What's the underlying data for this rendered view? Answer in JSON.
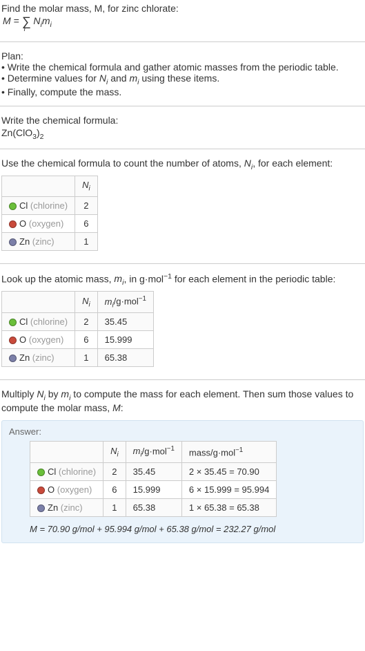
{
  "intro": {
    "line1": "Find the molar mass, M, for zinc chlorate:",
    "eq": "M = ∑ N_i m_i",
    "eq_sub": "i"
  },
  "plan": {
    "heading": "Plan:",
    "b1": "• Write the chemical formula and gather atomic masses from the periodic table.",
    "b2_a": "• Determine values for ",
    "b2_n": "N",
    "b2_and": " and ",
    "b2_m": "m",
    "b2_end": " using these items.",
    "b3": "• Finally, compute the mass."
  },
  "cf": {
    "heading": "Write the chemical formula:",
    "formula_a": "Zn(ClO",
    "formula_b": "3",
    "formula_c": ")",
    "formula_d": "2"
  },
  "count": {
    "heading_a": "Use the chemical formula to count the number of atoms, ",
    "heading_n": "N",
    "heading_b": ", for each element:",
    "col_n": "N",
    "col_n_sub": "i",
    "r1_sym": "Cl",
    "r1_name": "(chlorine)",
    "r1_n": "2",
    "r2_sym": "O",
    "r2_name": "(oxygen)",
    "r2_n": "6",
    "r3_sym": "Zn",
    "r3_name": "(zinc)",
    "r3_n": "1"
  },
  "mass": {
    "heading_a": "Look up the atomic mass, ",
    "heading_m": "m",
    "heading_b": ", in g·mol",
    "heading_c": " for each element in the periodic table:",
    "col_m": "m",
    "col_m_sub": "i",
    "col_m_unit": "/g·mol",
    "neg1": "−1",
    "r1_m": "35.45",
    "r2_m": "15.999",
    "r3_m": "65.38"
  },
  "mult": {
    "heading_a": "Multiply ",
    "heading_b": " by ",
    "heading_c": " to compute the mass for each element. Then sum those values to compute the molar mass, ",
    "heading_M": "M",
    "heading_d": ":"
  },
  "answer": {
    "label": "Answer:",
    "col_mass": "mass/g·mol",
    "r1_calc": "2 × 35.45 = 70.90",
    "r2_calc": "6 × 15.999 = 95.994",
    "r3_calc": "1 × 65.38 = 65.38",
    "final": "M = 70.90 g/mol + 95.994 g/mol + 65.38 g/mol = 232.27 g/mol"
  },
  "chart_data": {
    "type": "table",
    "title": "Molar mass of zinc chlorate Zn(ClO3)2",
    "elements": [
      {
        "symbol": "Cl",
        "name": "chlorine",
        "N_i": 2,
        "m_i_g_per_mol": 35.45,
        "mass_g_per_mol": 70.9
      },
      {
        "symbol": "O",
        "name": "oxygen",
        "N_i": 6,
        "m_i_g_per_mol": 15.999,
        "mass_g_per_mol": 95.994
      },
      {
        "symbol": "Zn",
        "name": "zinc",
        "N_i": 1,
        "m_i_g_per_mol": 65.38,
        "mass_g_per_mol": 65.38
      }
    ],
    "molar_mass_g_per_mol": 232.27
  }
}
